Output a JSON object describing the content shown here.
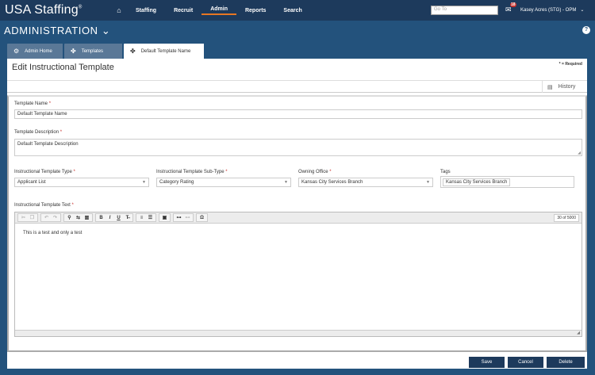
{
  "header": {
    "brand": "USA Staffing",
    "brand_mark": "®",
    "home_icon": "home-icon",
    "nav": [
      "Staffing",
      "Recruit",
      "Admin",
      "Reports",
      "Search"
    ],
    "active_nav": "Admin",
    "goto_placeholder": "Go To",
    "mail_icon": "envelope-icon",
    "mail_count": "18",
    "user": "Kasey Acres (STG) - OPM"
  },
  "adminbar": {
    "title": "ADMINISTRATION",
    "help": "?"
  },
  "tabs": [
    {
      "label": "Admin Home",
      "icon": "gear-icon"
    },
    {
      "label": "Templates",
      "icon": "puzzle-icon"
    },
    {
      "label": "Default Template Name",
      "icon": "puzzle-icon"
    }
  ],
  "page": {
    "title": "Edit Instructional Template",
    "required_note": "* = Required",
    "history_label": "History"
  },
  "form": {
    "name_label": "Template Name",
    "name_value": "Default Template Name",
    "desc_label": "Template Description",
    "desc_value": "Default Template Description",
    "type_label": "Instructional Template Type",
    "type_value": "Applicant List",
    "subtype_label": "Instructional Template Sub-Type",
    "subtype_value": "Category Rating",
    "office_label": "Owning Office",
    "office_value": "Kansas City Services Branch",
    "tags_label": "Tags",
    "tags_value": "Kansas City Services Branch",
    "text_label": "Instructional Template Text",
    "required_star": "*"
  },
  "editor": {
    "counter": "30 of 5000",
    "content": "This is a test and only a test"
  },
  "buttons": {
    "save": "Save",
    "cancel": "Cancel",
    "delete": "Delete"
  }
}
